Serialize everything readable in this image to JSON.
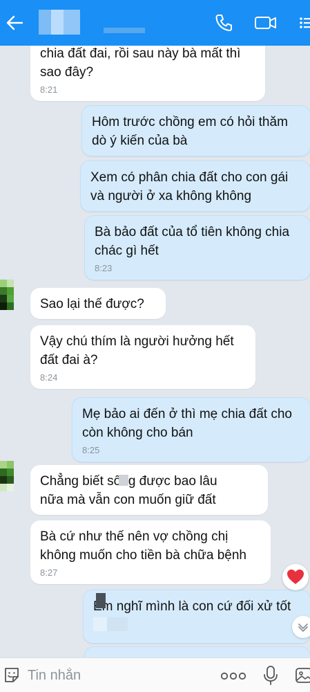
{
  "header": {
    "back_icon": "arrow-left-icon",
    "call_icon": "phone-icon",
    "video_icon": "video-camera-icon",
    "menu_icon": "menu-icon",
    "bg_color": "#1a8ff5"
  },
  "messages": [
    {
      "dir": "in",
      "lines": [
        "chia đất đai, rồi sau này bà mất thì",
        "sao đây?"
      ],
      "time": "8:21"
    },
    {
      "dir": "out",
      "lines": [
        "Hôm trước chồng em có hỏi thăm",
        "dò ý kiến của bà"
      ],
      "time": ""
    },
    {
      "dir": "out",
      "lines": [
        "Xem có phân chia đất cho con gái",
        "và người ở xa không không"
      ],
      "time": ""
    },
    {
      "dir": "out",
      "lines": [
        "Bà bảo đất của tổ tiên không chia",
        "chác gì hết"
      ],
      "time": "8:23"
    },
    {
      "dir": "in",
      "lines": [
        "Sao lại thế được?"
      ],
      "time": ""
    },
    {
      "dir": "in",
      "lines": [
        "Vậy chú thím là người hưởng hết",
        "đất đai à?"
      ],
      "time": "8:24"
    },
    {
      "dir": "out",
      "lines": [
        "Mẹ bảo ai đến ở thì mẹ chia đất cho",
        "còn không cho bán"
      ],
      "time": "8:25"
    },
    {
      "dir": "in",
      "lines": [
        "Chẳng biết        sống được bao lâu",
        "nữa mà vẫn con muốn giữ đất"
      ],
      "time": ""
    },
    {
      "dir": "in",
      "lines": [
        "Bà cứ như thế nên vợ chồng chị",
        "không muốn cho tiền bà chữa bệnh"
      ],
      "time": "8:27"
    },
    {
      "dir": "out",
      "lines": [
        "Em nghĩ mình là con cứ đối xử tốt",
        ""
      ],
      "time": ""
    }
  ],
  "input": {
    "placeholder": "Tin nhắn",
    "emoji_icon": "sticker-smile-icon",
    "more_icon": "more-dots-icon",
    "mic_icon": "microphone-icon",
    "image_icon": "image-icon"
  },
  "reactions": {
    "heart_icon": "heart-icon",
    "scroll_icon": "chevron-down-icon",
    "heart_color": "#e8313f"
  }
}
